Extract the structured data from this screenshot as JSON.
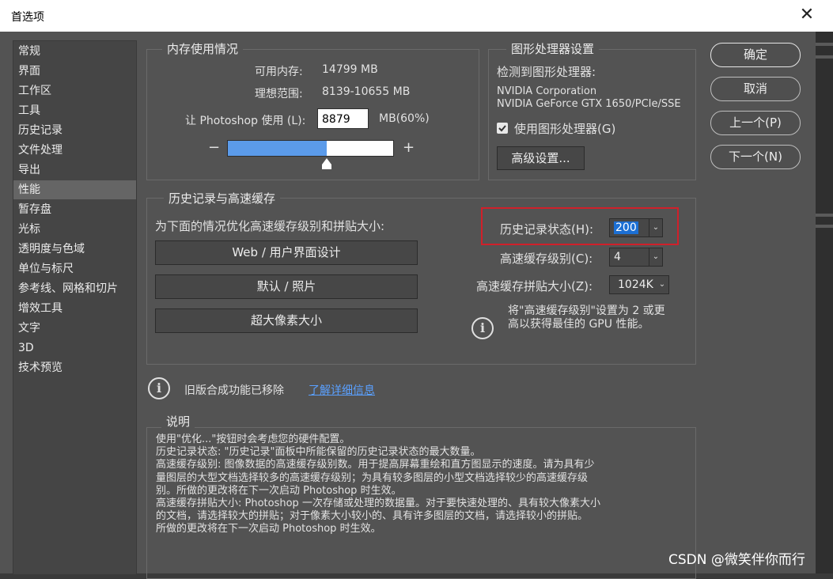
{
  "window": {
    "title": "首选项",
    "close_glyph": "✕"
  },
  "sidebar": {
    "selected_index": 7,
    "items": [
      {
        "label": "常规"
      },
      {
        "label": "界面"
      },
      {
        "label": "工作区"
      },
      {
        "label": "工具"
      },
      {
        "label": "历史记录"
      },
      {
        "label": "文件处理"
      },
      {
        "label": "导出"
      },
      {
        "label": "性能"
      },
      {
        "label": "暂存盘"
      },
      {
        "label": "光标"
      },
      {
        "label": "透明度与色域"
      },
      {
        "label": "单位与标尺"
      },
      {
        "label": "参考线、网格和切片"
      },
      {
        "label": "增效工具"
      },
      {
        "label": "文字"
      },
      {
        "label": "3D"
      },
      {
        "label": "技术预览"
      }
    ]
  },
  "memory": {
    "title": "内存使用情况",
    "available_label": "可用内存:",
    "available_value": "14799 MB",
    "ideal_label": "理想范围:",
    "ideal_value": "8139-10655 MB",
    "use_label": "让 Photoshop 使用 (L):",
    "use_value": "8879",
    "use_unit": "MB(60%)",
    "minus": "−",
    "plus": "+",
    "slider_fraction": 0.6
  },
  "gpu": {
    "title": "图形处理器设置",
    "detected_label": "检测到图形处理器:",
    "vendor": "NVIDIA Corporation",
    "model": "NVIDIA GeForce GTX 1650/PCIe/SSE",
    "use_gpu_label": "使用图形处理器(G)",
    "use_gpu_checked": true,
    "advanced_button": "高级设置..."
  },
  "history_cache": {
    "title": "历史记录与高速缓存",
    "optimize_label": "为下面的情况优化高速缓存级别和拼贴大小:",
    "preset_buttons": [
      "Web / 用户界面设计",
      "默认 / 照片",
      "超大像素大小"
    ],
    "history_states_label": "历史记录状态(H):",
    "history_states_value": "200",
    "cache_levels_label": "高速缓存级别(C):",
    "cache_levels_value": "4",
    "tile_size_label": "高速缓存拼贴大小(Z):",
    "tile_size_value": "1024K",
    "gpu_tip_line1": "将\"高速缓存级别\"设置为 2 或更",
    "gpu_tip_line2": "高以获得最佳的 GPU 性能。",
    "highlight_color": "#d0202a"
  },
  "legacy": {
    "text": "旧版合成功能已移除",
    "link": "了解详细信息",
    "link_color": "#5aa0ff"
  },
  "description": {
    "title": "说明",
    "lines": [
      "使用\"优化...\"按钮时会考虑您的硬件配置。",
      "历史记录状态: \"历史记录\"面板中所能保留的历史记录状态的最大数量。",
      "高速缓存级别: 图像数据的高速缓存级别数。用于提高屏幕重绘和直方图显示的速度。请为具有少",
      "量图层的大型文档选择较多的高速缓存级别；为具有较多图层的小型文档选择较少的高速缓存级",
      "别。所做的更改将在下一次启动 Photoshop 时生效。",
      "高速缓存拼贴大小: Photoshop 一次存储或处理的数据量。对于要快速处理的、具有较大像素大小",
      "的文档，请选择较大的拼贴；对于像素大小较小的、具有许多图层的文档，请选择较小的拼贴。",
      "所做的更改将在下一次启动 Photoshop 时生效。"
    ]
  },
  "buttons": {
    "ok": "确定",
    "cancel": "取消",
    "prev": "上一个(P)",
    "next": "下一个(N)"
  },
  "watermark": "CSDN @微笑伴你而行",
  "icons": {
    "info": "info-icon",
    "check": "checkmark-icon",
    "dropdown": "chevron-down-icon"
  }
}
